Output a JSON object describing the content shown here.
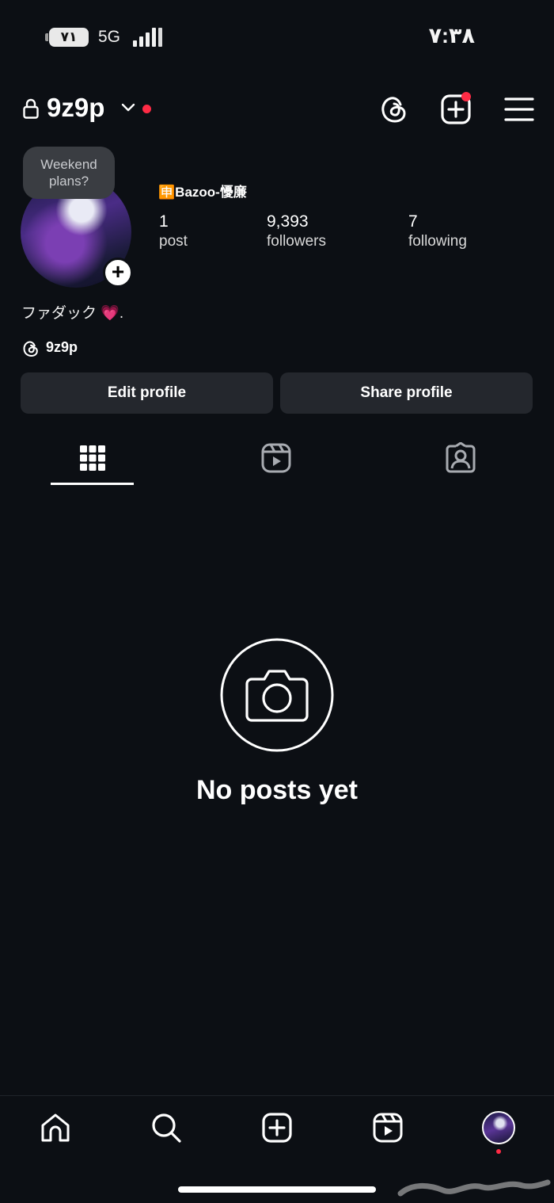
{
  "status_bar": {
    "battery": "٧١",
    "network": "5G",
    "time": "٧:٣٨"
  },
  "header": {
    "username": "9z9p",
    "icons": [
      "lock-icon",
      "chevron-down-icon",
      "threads-icon",
      "create-icon",
      "menu-icon"
    ]
  },
  "profile": {
    "note": "Weekend plans?",
    "display_name": "🈸Bazoo-懮廉",
    "bio": "ファダック 💗.",
    "threads_handle": "9z9p",
    "stats": [
      {
        "value": "1",
        "label": "post"
      },
      {
        "value": "9,393",
        "label": "followers"
      },
      {
        "value": "7",
        "label": "following"
      }
    ]
  },
  "actions": {
    "edit": "Edit profile",
    "share": "Share profile"
  },
  "tabs": [
    "grid-icon",
    "reels-icon",
    "tagged-icon"
  ],
  "empty_state": {
    "title": "No posts yet",
    "icon": "camera-icon"
  },
  "bottom_nav": [
    "home-icon",
    "search-icon",
    "create-icon",
    "reels-icon",
    "profile-avatar"
  ],
  "colors": {
    "background": "#0c0f14",
    "button": "#24272d",
    "notification_dot": "#ff2b45"
  }
}
